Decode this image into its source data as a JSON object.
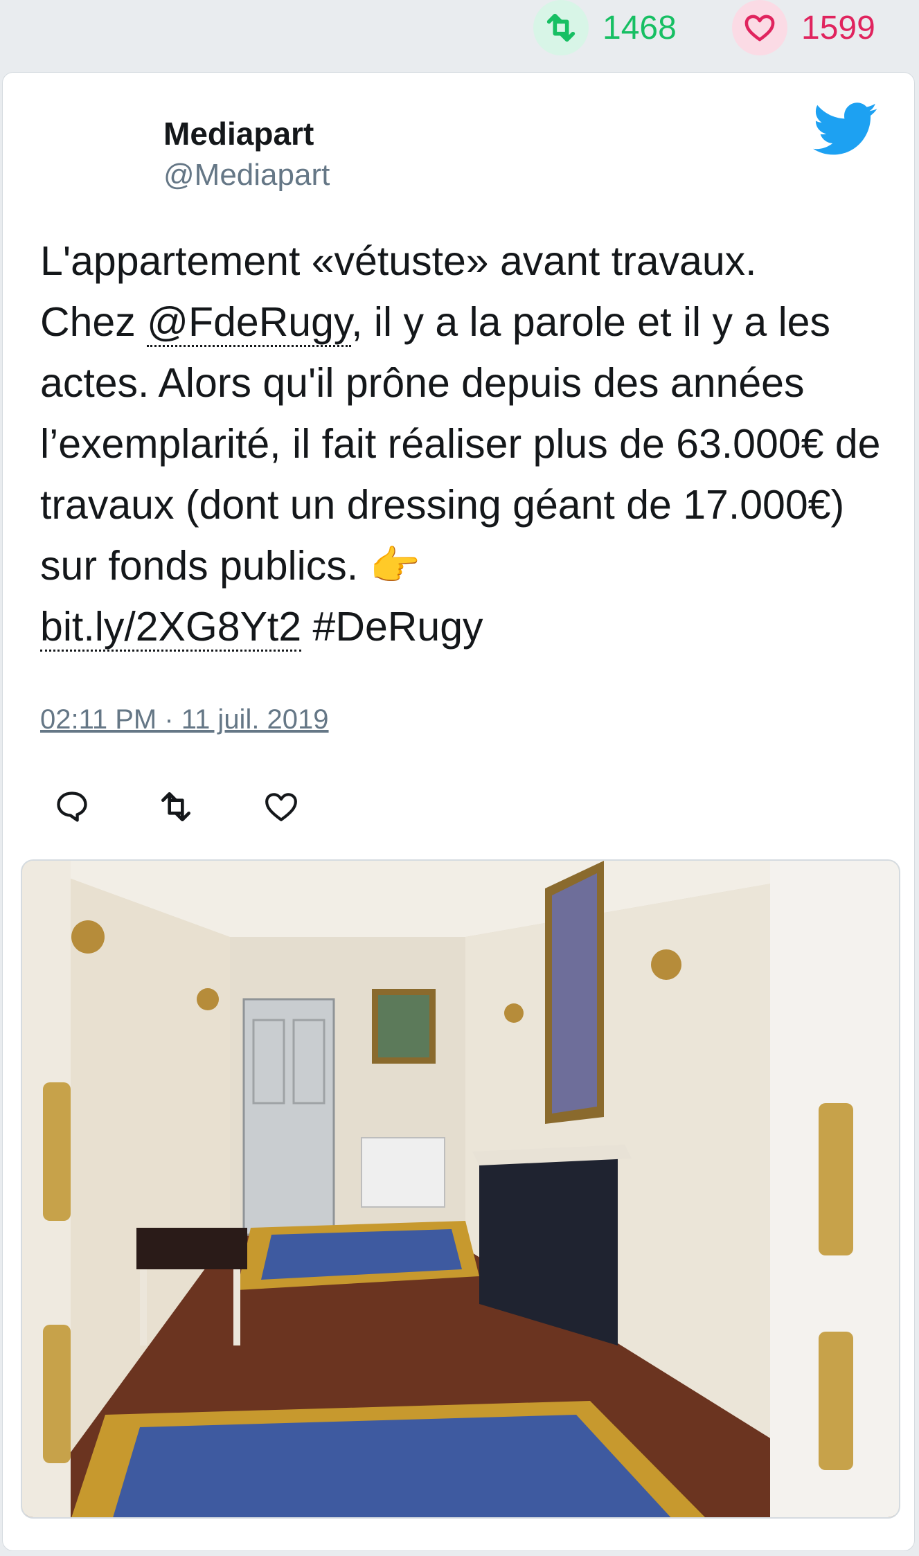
{
  "stats": {
    "retweets": "1468",
    "likes": "1599",
    "retweet_color": "#17bf63",
    "like_color": "#e0245e"
  },
  "author": {
    "name": "Mediapart",
    "handle": "@Mediapart"
  },
  "tweet": {
    "text_1": "L'appartement «vétuste» avant travaux.\nChez ",
    "mention": "@FdeRugy",
    "text_2": ", il y a la parole et il y a les actes. Alors qu'il prône depuis des années l’exemplarité, il fait réaliser plus de 63.000€ de travaux (dont un dressing géant de 17.000€) sur fonds publics. ",
    "emoji": "👉",
    "link": "bit.ly/2XG8Yt2",
    "hashtag": " #DeRugy"
  },
  "timestamp": "02:11 PM · 11 juil. 2019",
  "actions": {
    "reply_icon": "reply-icon",
    "retweet_icon": "retweet-icon",
    "like_icon": "heart-icon"
  },
  "media": {
    "description_icon": "photo-hallway"
  },
  "brand_icon": "twitter-bird-icon",
  "twitter_blue": "#1da1f2"
}
